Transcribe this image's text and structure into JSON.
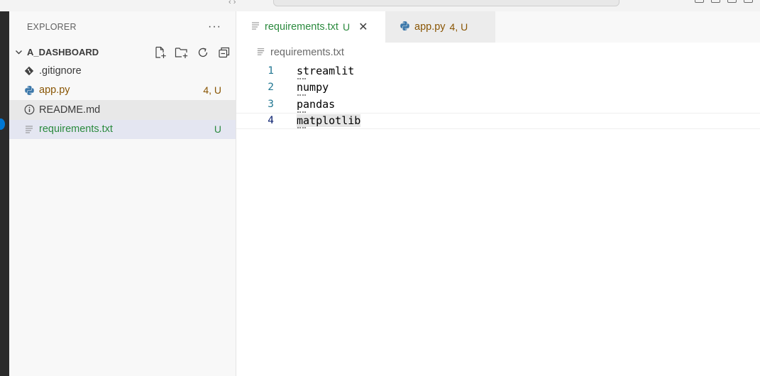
{
  "titlebar": {
    "nav_arrows": "‹  ›"
  },
  "sidebar": {
    "title": "EXPLORER",
    "more_label": "···",
    "folder": {
      "name": "A_DASHBOARD"
    },
    "files": [
      {
        "name": ".gitignore",
        "icon": "git-icon",
        "badge": ""
      },
      {
        "name": "app.py",
        "icon": "python-icon",
        "badge": "4, U"
      },
      {
        "name": "README.md",
        "icon": "info-icon",
        "badge": ""
      },
      {
        "name": "requirements.txt",
        "icon": "text-file-icon",
        "badge": "U"
      }
    ]
  },
  "editor": {
    "tabs": [
      {
        "label": "requirements.txt",
        "badge": "U",
        "close": "✕"
      },
      {
        "label": "app.py",
        "badge": "4, U"
      }
    ],
    "breadcrumb": "requirements.txt",
    "lines": [
      {
        "number": "1",
        "text": "streamlit"
      },
      {
        "number": "2",
        "text": "numpy"
      },
      {
        "number": "3",
        "text": "pandas"
      },
      {
        "number": "4",
        "text": "matplotlib"
      }
    ]
  },
  "colors": {
    "modified": "#895503",
    "untracked": "#2b8a3e",
    "line_number": "#237893",
    "accent": "#0078d4"
  }
}
